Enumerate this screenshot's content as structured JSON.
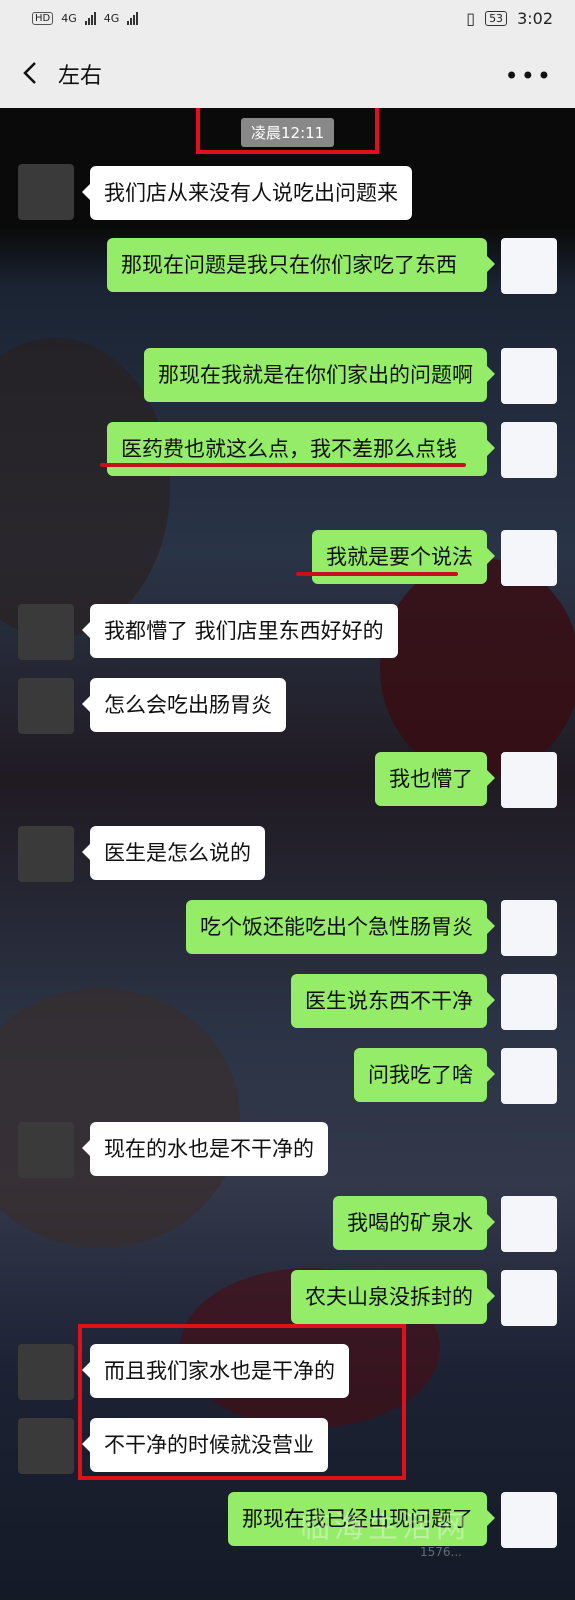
{
  "status_bar": {
    "hd": "HD",
    "net1": "4G",
    "net2": "4G",
    "battery": "53",
    "time": "3:02"
  },
  "header": {
    "title": "左右"
  },
  "timestamp": "凌晨12:11",
  "colors": {
    "incoming_bubble": "#ffffff",
    "outgoing_bubble": "#95ec69",
    "highlight_red": "#e0101a"
  },
  "messages": [
    {
      "side": "left",
      "text": "我们店从来没有人说吃出问题来"
    },
    {
      "side": "right",
      "text": "那现在问题是我只在你们家吃了东西"
    },
    {
      "side": "right",
      "text": "那现在我就是在你们家出的问题啊"
    },
    {
      "side": "right",
      "text": "医药费也就这么点，我不差那么点钱"
    },
    {
      "side": "right",
      "text": "我就是要个说法"
    },
    {
      "side": "left",
      "text": "我都懵了 我们店里东西好好的"
    },
    {
      "side": "left",
      "text": "怎么会吃出肠胃炎"
    },
    {
      "side": "right",
      "text": "我也懵了"
    },
    {
      "side": "left",
      "text": "医生是怎么说的"
    },
    {
      "side": "right",
      "text": "吃个饭还能吃出个急性肠胃炎"
    },
    {
      "side": "right",
      "text": "医生说东西不干净"
    },
    {
      "side": "right",
      "text": "问我吃了啥"
    },
    {
      "side": "left",
      "text": "现在的水也是不干净的"
    },
    {
      "side": "right",
      "text": "我喝的矿泉水"
    },
    {
      "side": "right",
      "text": "农夫山泉没拆封的"
    },
    {
      "side": "left",
      "text": "而且我们家水也是干净的"
    },
    {
      "side": "left",
      "text": "不干净的时候就没营业"
    },
    {
      "side": "right",
      "text": "那现在我已经出现问题了"
    }
  ],
  "watermark": {
    "text": "临海生活网",
    "sub": "1576..."
  }
}
